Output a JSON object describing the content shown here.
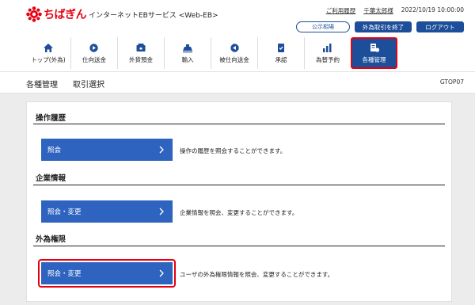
{
  "header": {
    "brand": "ちばぎん",
    "service": "インターネットEBサービス <Web-EB>",
    "help_link": "ご利用履歴",
    "user_name": "千葉太郎様",
    "datetime": "2022/10/19 10:00:00",
    "notice_button": "公示相場",
    "fx_end_button": "外為取引を終了",
    "logout_button": "ログアウト",
    "brand_color": "#e60012",
    "accent_color": "#1d4e9a"
  },
  "nav": {
    "items": [
      {
        "label": "トップ(外為)",
        "icon": "home-icon"
      },
      {
        "label": "仕向送金",
        "icon": "outgoing-remittance-icon"
      },
      {
        "label": "外貨預金",
        "icon": "foreign-deposit-icon"
      },
      {
        "label": "輸入",
        "icon": "import-icon"
      },
      {
        "label": "被仕向送金",
        "icon": "incoming-remittance-icon"
      },
      {
        "label": "承認",
        "icon": "approval-icon"
      },
      {
        "label": "為替予約",
        "icon": "fx-contract-icon"
      },
      {
        "label": "各種管理",
        "icon": "management-icon",
        "active": true
      }
    ]
  },
  "subheader": {
    "section": "各種管理",
    "page": "取引選択",
    "screen_id": "GTOP07"
  },
  "sections": [
    {
      "title": "操作履歴",
      "button": "照会",
      "description": "操作の履歴を照会することができます。"
    },
    {
      "title": "企業情報",
      "button": "照会・変更",
      "description": "企業情報を照会、変更することができます。"
    },
    {
      "title": "外為権限",
      "button": "照会・変更",
      "description": "ユーザの外為権限情報を照会、変更することができます。"
    }
  ]
}
